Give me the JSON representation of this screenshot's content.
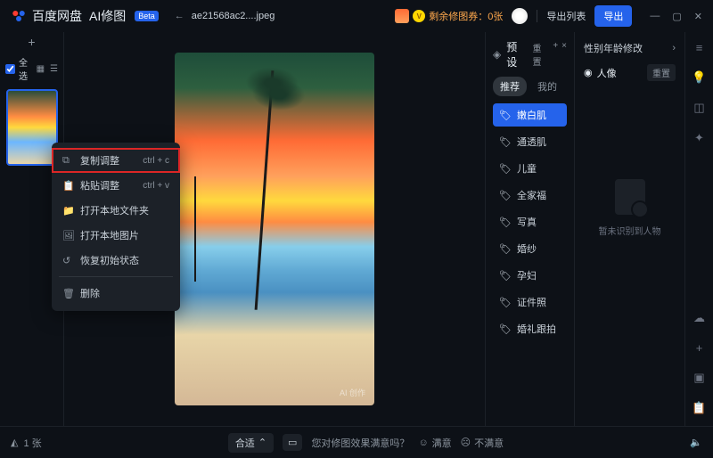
{
  "titlebar": {
    "brand": "百度网盘",
    "product": "AI修图",
    "beta": "Beta",
    "filename": "ae21568ac2....jpeg",
    "coupon_text": "剩余修图券：0张",
    "export_list": "导出列表",
    "export": "导出"
  },
  "thumbs": {
    "select_all": "全选"
  },
  "context_menu": {
    "items": [
      {
        "icon": "⧉",
        "label": "复制调整",
        "shortcut": "ctrl + c",
        "highlighted": true
      },
      {
        "icon": "📋",
        "label": "粘贴调整",
        "shortcut": "ctrl + v"
      },
      {
        "icon": "📁",
        "label": "打开本地文件夹"
      },
      {
        "icon": "🖼",
        "label": "打开本地图片"
      },
      {
        "icon": "↺",
        "label": "恢复初始状态"
      },
      {
        "icon": "🗑",
        "label": "删除"
      }
    ]
  },
  "presets": {
    "title": "预设",
    "reset": "重置",
    "tabs": [
      "推荐",
      "我的"
    ],
    "active_tab": 0,
    "items": [
      "嫩白肌",
      "通透肌",
      "儿童",
      "全家福",
      "写真",
      "婚纱",
      "孕妇",
      "证件照",
      "婚礼跟拍"
    ],
    "active_item": 0
  },
  "props": {
    "row1": "性别年龄修改",
    "section_title": "人像",
    "section_reset": "重置",
    "empty_text": "暂未识别到人物"
  },
  "watermark": "AI 创作",
  "bottom": {
    "count_label": "1 张",
    "fit": "合适",
    "feedback_q": "您对修图效果满意吗？",
    "satisfied": "满意",
    "unsatisfied": "不满意"
  }
}
